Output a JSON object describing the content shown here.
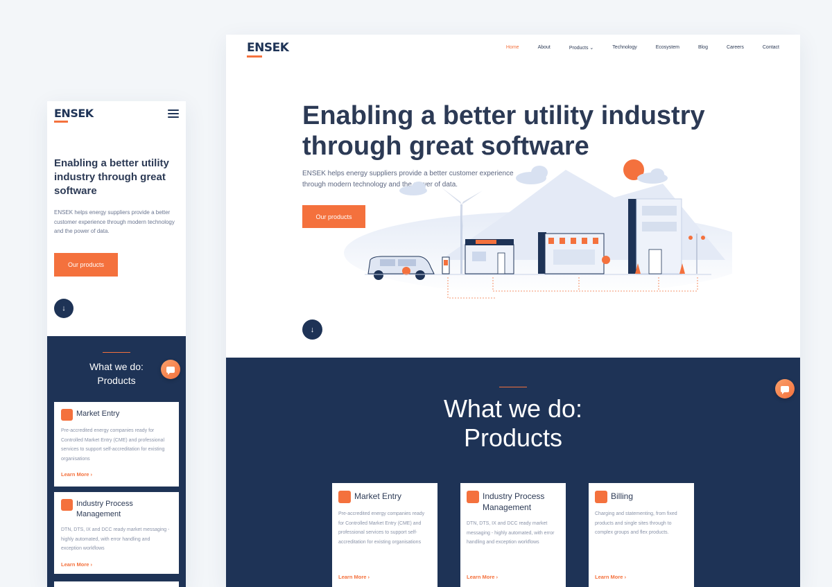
{
  "brand": {
    "logo": "ENSEK",
    "accent": "#f4713d",
    "navy": "#1e3356"
  },
  "nav": {
    "items": [
      {
        "label": "Home"
      },
      {
        "label": "About"
      },
      {
        "label": "Products ⌄"
      },
      {
        "label": "Technology"
      },
      {
        "label": "Ecosystem"
      },
      {
        "label": "Blog"
      },
      {
        "label": "Careers"
      },
      {
        "label": "Contact"
      }
    ]
  },
  "hero": {
    "desktop_title": "Enabling a better utility industry through great software",
    "mobile_title": "Enabling a better utility industry through great software",
    "subtitle": "ENSEK helps energy suppliers provide a better customer experience through modern technology and the power of data.",
    "cta": "Our products",
    "scroll_icon": "arrow-down-icon"
  },
  "products_section": {
    "title_line1": "What we do:",
    "title_line2": "Products",
    "cards": [
      {
        "title": "Market Entry",
        "description": "Pre-accredited energy companies ready for Controlled Market Entry (CME) and professional services to support self-accreditation for existing organisations",
        "link": "Learn More ›",
        "icon": "market-entry-icon"
      },
      {
        "title": "Industry Process Management",
        "description": "DTN, DTS, IX and DCC ready market messaging - highly automated, with error handling and exception workflows",
        "link": "Learn More ›",
        "icon": "industry-process-icon"
      },
      {
        "title": "Billing",
        "description": "Charging and statementing, from fixed products and single sites through to complex groups and flex products.",
        "link": "Learn More ›",
        "icon": "billing-icon"
      }
    ],
    "mobile_cards": [
      {
        "title": "Market Entry",
        "description": "Pre-accredited energy companies ready for Controlled Market Entry (CME) and professional services to support self-accreditation for existing organisations",
        "link": "Learn More ›"
      },
      {
        "title": "Industry Process Management",
        "description": "DTN, DTS, IX and DCC ready market messaging - highly automated, with error handling and exception workflows",
        "link": "Learn More ›"
      }
    ]
  },
  "chat": {
    "icon": "chat-bubble-icon"
  }
}
